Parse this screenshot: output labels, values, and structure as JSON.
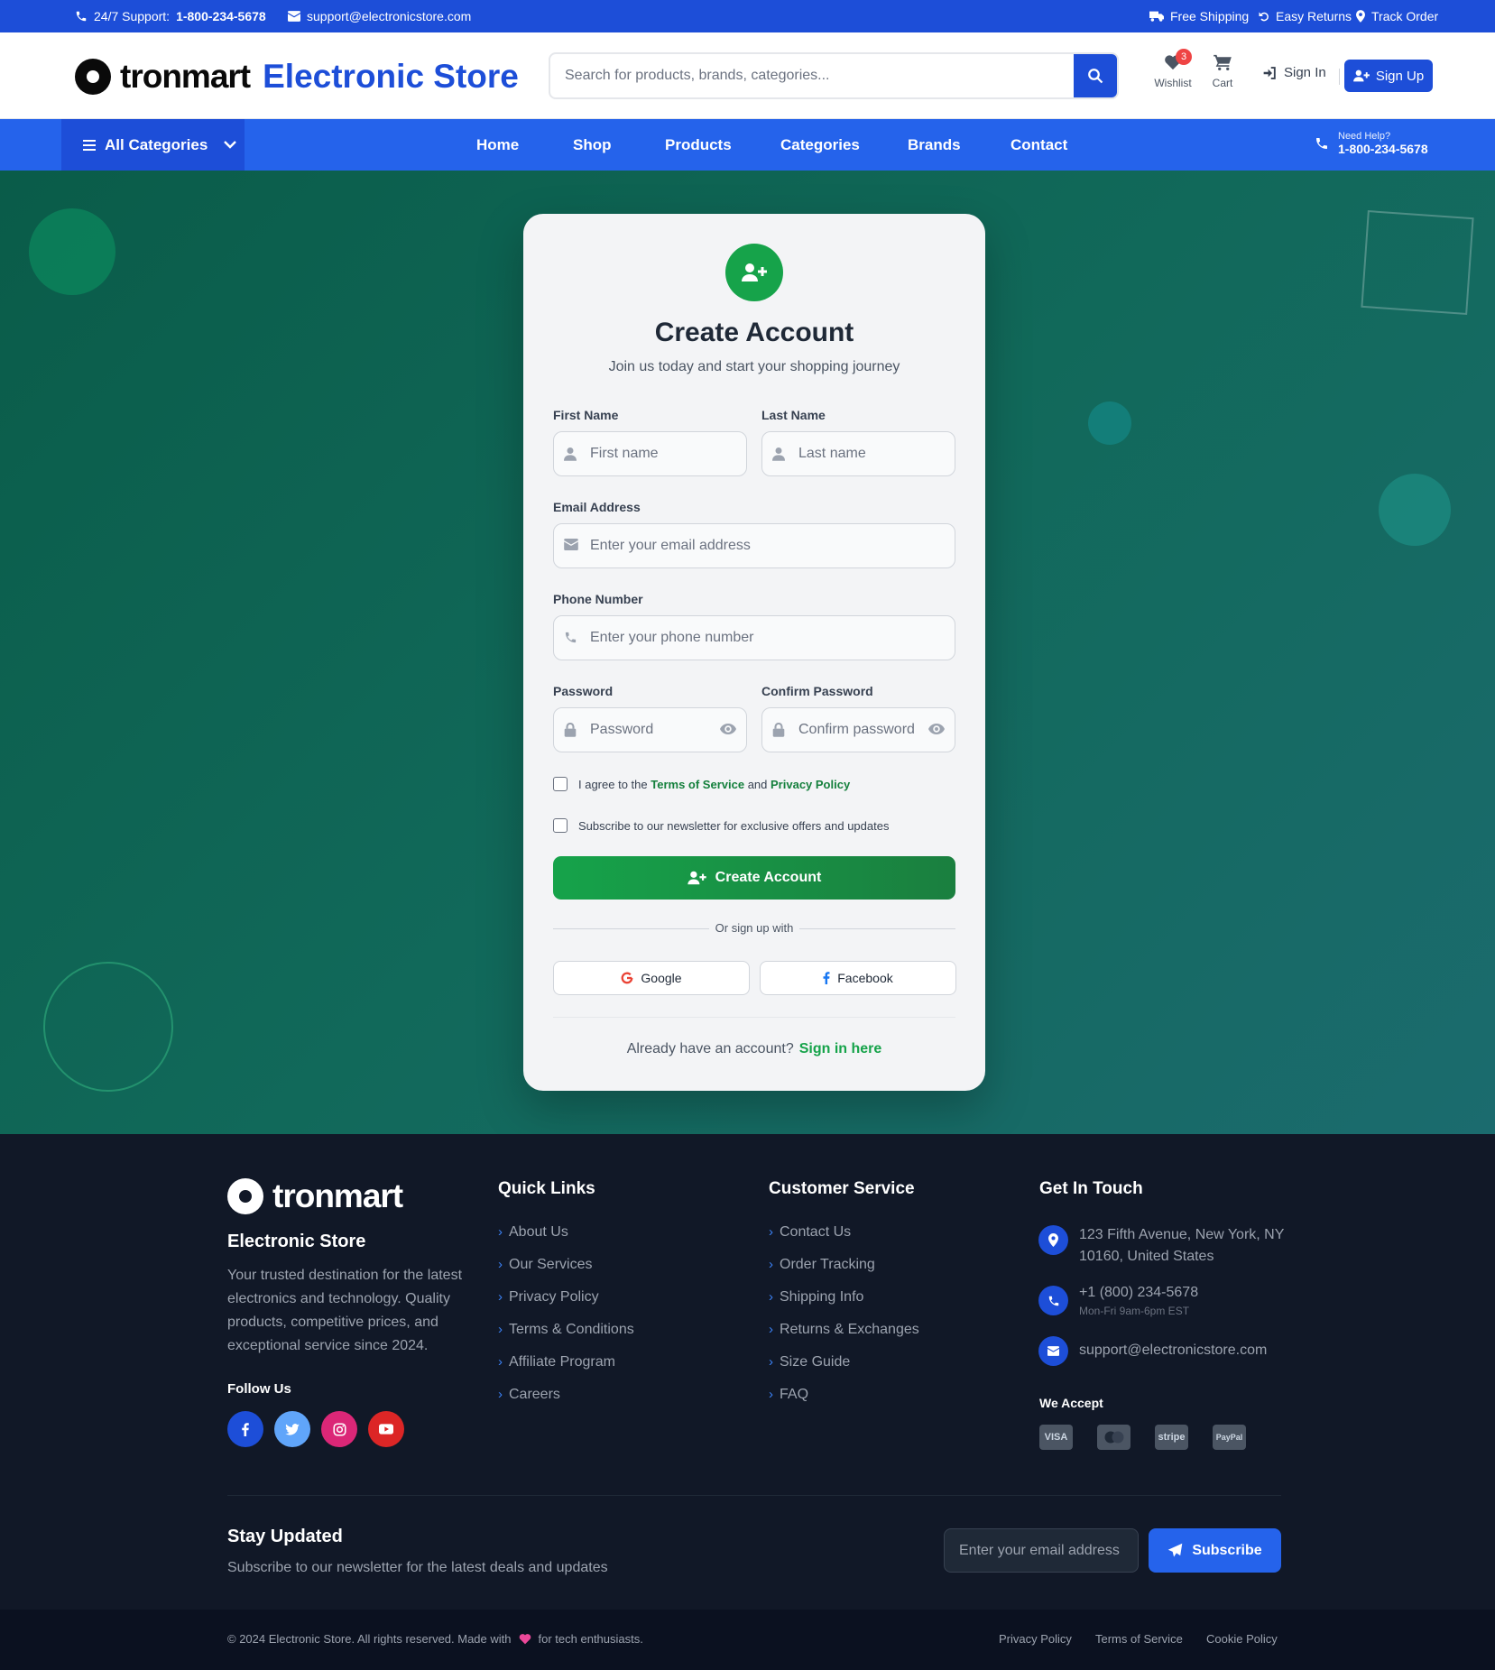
{
  "topbar": {
    "support_prefix": "24/7 Support:",
    "support_phone": "1-800-234-5678",
    "email": "support@electronicstore.com",
    "free_shipping": "Free Shipping",
    "easy_returns": "Easy Returns",
    "track_order": "Track Order"
  },
  "header": {
    "logo_word": "tronmart",
    "store_name": "Electronic Store",
    "search_placeholder": "Search for products, brands, categories...",
    "wishlist_label": "Wishlist",
    "wishlist_count": "3",
    "cart_label": "Cart",
    "signin_label": "Sign In",
    "signup_label": "Sign Up"
  },
  "nav": {
    "all_categories": "All Categories",
    "links": [
      "Home",
      "Shop",
      "Products",
      "Categories",
      "Brands",
      "Contact"
    ],
    "help_label": "Need Help?",
    "help_phone": "1-800-234-5678"
  },
  "form": {
    "title": "Create Account",
    "subtitle": "Join us today and start your shopping journey",
    "first_name_label": "First Name",
    "first_name_placeholder": "First name",
    "last_name_label": "Last Name",
    "last_name_placeholder": "Last name",
    "email_label": "Email Address",
    "email_placeholder": "Enter your email address",
    "phone_label": "Phone Number",
    "phone_placeholder": "Enter your phone number",
    "password_label": "Password",
    "password_placeholder": "Password",
    "confirm_label": "Confirm Password",
    "confirm_placeholder": "Confirm password",
    "agree_prefix": "I agree to the",
    "terms_link": "Terms of Service",
    "agree_and": "and",
    "privacy_link": "Privacy Policy",
    "newsletter_opt": "Subscribe to our newsletter for exclusive offers and updates",
    "submit": "Create Account",
    "or_text": "Or sign up with",
    "google": "Google",
    "facebook": "Facebook",
    "already_text": "Already have an account?",
    "signin_link": "Sign in here"
  },
  "footer": {
    "logo_word": "tronmart",
    "store_name": "Electronic Store",
    "description": "Your trusted destination for the latest electronics and technology. Quality products, competitive prices, and exceptional service since 2024.",
    "follow_us": "Follow Us",
    "quick_links_title": "Quick Links",
    "quick_links": [
      "About Us",
      "Our Services",
      "Privacy Policy",
      "Terms & Conditions",
      "Affiliate Program",
      "Careers"
    ],
    "service_title": "Customer Service",
    "service_links": [
      "Contact Us",
      "Order Tracking",
      "Shipping Info",
      "Returns & Exchanges",
      "Size Guide",
      "FAQ"
    ],
    "contact_title": "Get In Touch",
    "address": "123 Fifth Avenue, New York, NY 10160, United States",
    "phone": "+1 (800) 234-5678",
    "hours": "Mon-Fri 9am-6pm EST",
    "email": "support@electronicstore.com",
    "we_accept": "We Accept",
    "payments": [
      "VISA",
      "MC",
      "stripe",
      "PayPal"
    ],
    "stay_title": "Stay Updated",
    "stay_sub": "Subscribe to our newsletter for the latest deals and updates",
    "newsletter_placeholder": "Enter your email address",
    "subscribe": "Subscribe"
  },
  "bottom": {
    "copy_prefix": "© 2024 Electronic Store. All rights reserved. Made with",
    "copy_suffix": "for tech enthusiasts.",
    "links": [
      "Privacy Policy",
      "Terms of Service",
      "Cookie Policy"
    ]
  },
  "colors": {
    "primary_blue": "#1d4ed8",
    "nav_blue": "#2563eb",
    "accent_green": "#16a34a",
    "footer_bg": "#111827"
  }
}
